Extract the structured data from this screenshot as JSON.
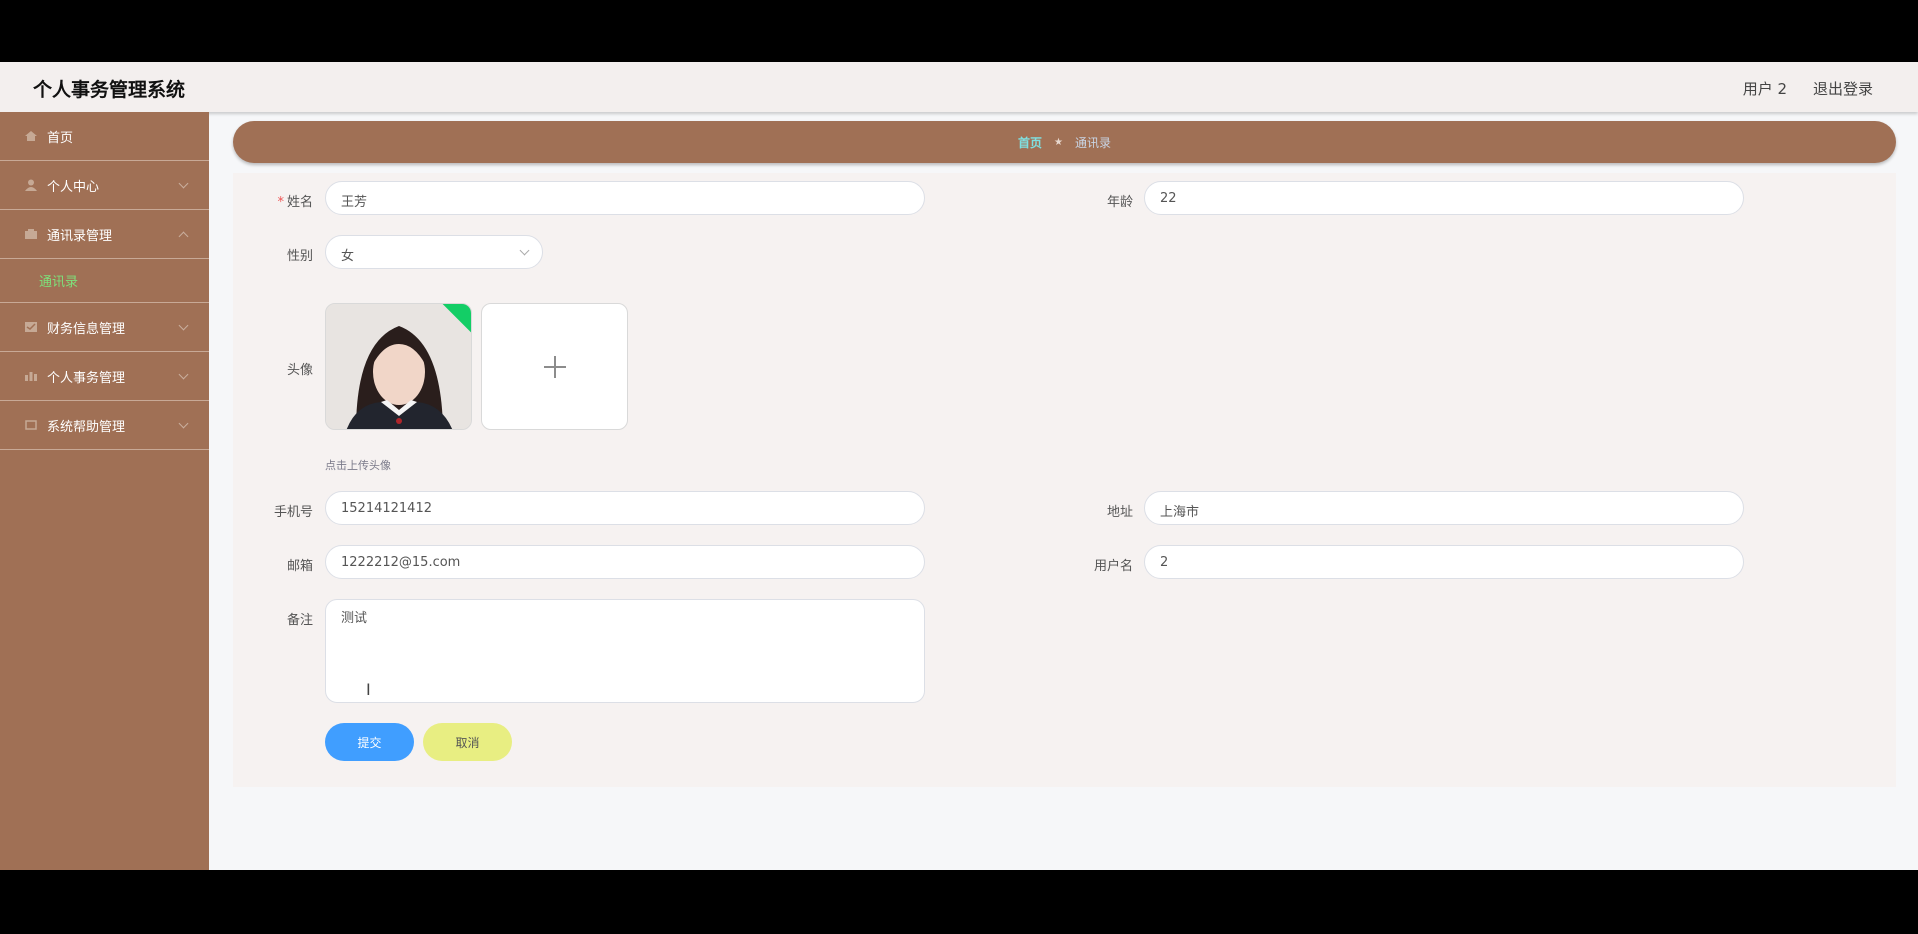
{
  "header": {
    "title": "个人事务管理系统",
    "user": "用户 2",
    "logout": "退出登录"
  },
  "sidebar": {
    "items": [
      {
        "label": "首页",
        "icon": "home-icon"
      },
      {
        "label": "个人中心",
        "icon": "user-icon"
      },
      {
        "label": "通讯录管理",
        "icon": "contacts-icon",
        "expanded": true,
        "children": [
          {
            "label": "通讯录",
            "active": true
          }
        ]
      },
      {
        "label": "财务信息管理",
        "icon": "finance-icon"
      },
      {
        "label": "个人事务管理",
        "icon": "chart-icon"
      },
      {
        "label": "系统帮助管理",
        "icon": "help-icon"
      }
    ]
  },
  "breadcrumb": {
    "home": "首页",
    "current": "通讯录"
  },
  "form": {
    "name_label": "姓名",
    "name_value": "王芳",
    "age_label": "年龄",
    "age_value": "22",
    "gender_label": "性别",
    "gender_value": "女",
    "avatar_label": "头像",
    "avatar_hint": "点击上传头像",
    "phone_label": "手机号",
    "phone_value": "15214121412",
    "address_label": "地址",
    "address_value": "上海市",
    "email_label": "邮箱",
    "email_value": "1222212@15.com",
    "username_label": "用户名",
    "username_value": "2",
    "remark_label": "备注",
    "remark_value": "测试",
    "submit": "提交",
    "cancel": "取消"
  },
  "colors": {
    "sidebar": "#a07055",
    "active_link": "#7ee07a",
    "primary": "#409eff",
    "cancel": "#e8ee82"
  }
}
